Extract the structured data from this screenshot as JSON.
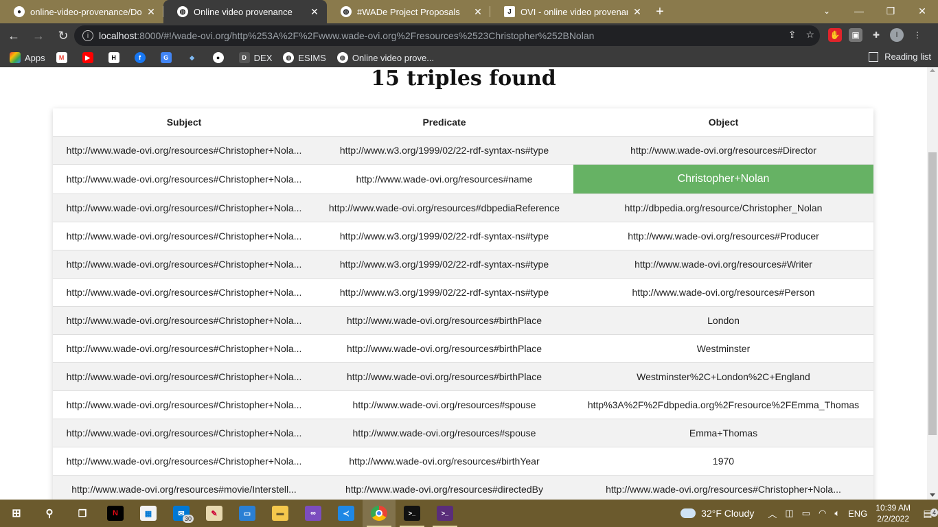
{
  "browser": {
    "tabs": [
      {
        "title": "online-video-provenance/Docum",
        "icon": "github-icon",
        "active": false
      },
      {
        "title": "Online video provenance",
        "icon": "globe-icon",
        "active": true
      },
      {
        "title": "#WADe Project Proposals",
        "icon": "globe-icon",
        "active": false
      },
      {
        "title": "OVI - online video provenance - ",
        "icon": "j-icon",
        "active": false
      }
    ],
    "url_host": "localhost",
    "url_rest": ":8000/#!/wade-ovi.org/http%253A%2F%2Fwww.wade-ovi.org%2Fresources%2523Christopher%252BNolan",
    "bookmarks": [
      {
        "label": "Apps",
        "icon": "apps-grid-icon"
      },
      {
        "label": "",
        "icon": "gmail-icon"
      },
      {
        "label": "",
        "icon": "youtube-icon"
      },
      {
        "label": "",
        "icon": "hbo-icon"
      },
      {
        "label": "",
        "icon": "facebook-icon"
      },
      {
        "label": "",
        "icon": "translate-icon"
      },
      {
        "label": "",
        "icon": "bird-icon"
      },
      {
        "label": "",
        "icon": "github-icon"
      },
      {
        "label": "DEX",
        "icon": "dex-icon"
      },
      {
        "label": "ESIMS",
        "icon": "globe-icon"
      },
      {
        "label": "Online video prove...",
        "icon": "globe-icon"
      }
    ],
    "reading_list": "Reading list",
    "profile_initial": "I"
  },
  "page": {
    "heading": "15 triples found",
    "columns": [
      "Subject",
      "Predicate",
      "Object"
    ],
    "rows": [
      [
        "http://www.wade-ovi.org/resources#Christopher+Nola...",
        "http://www.w3.org/1999/02/22-rdf-syntax-ns#type",
        "http://www.wade-ovi.org/resources#Director"
      ],
      [
        "http://www.wade-ovi.org/resources#Christopher+Nola...",
        "http://www.wade-ovi.org/resources#name",
        "Christopher+Nolan"
      ],
      [
        "http://www.wade-ovi.org/resources#Christopher+Nola...",
        "http://www.wade-ovi.org/resources#dbpediaReference",
        "http://dbpedia.org/resource/Christopher_Nolan"
      ],
      [
        "http://www.wade-ovi.org/resources#Christopher+Nola...",
        "http://www.w3.org/1999/02/22-rdf-syntax-ns#type",
        "http://www.wade-ovi.org/resources#Producer"
      ],
      [
        "http://www.wade-ovi.org/resources#Christopher+Nola...",
        "http://www.w3.org/1999/02/22-rdf-syntax-ns#type",
        "http://www.wade-ovi.org/resources#Writer"
      ],
      [
        "http://www.wade-ovi.org/resources#Christopher+Nola...",
        "http://www.w3.org/1999/02/22-rdf-syntax-ns#type",
        "http://www.wade-ovi.org/resources#Person"
      ],
      [
        "http://www.wade-ovi.org/resources#Christopher+Nola...",
        "http://www.wade-ovi.org/resources#birthPlace",
        "London"
      ],
      [
        "http://www.wade-ovi.org/resources#Christopher+Nola...",
        "http://www.wade-ovi.org/resources#birthPlace",
        "Westminster"
      ],
      [
        "http://www.wade-ovi.org/resources#Christopher+Nola...",
        "http://www.wade-ovi.org/resources#birthPlace",
        "Westminster%2C+London%2C+England"
      ],
      [
        "http://www.wade-ovi.org/resources#Christopher+Nola...",
        "http://www.wade-ovi.org/resources#spouse",
        "http%3A%2F%2Fdbpedia.org%2Fresource%2FEmma_Thomas"
      ],
      [
        "http://www.wade-ovi.org/resources#Christopher+Nola...",
        "http://www.wade-ovi.org/resources#spouse",
        "Emma+Thomas"
      ],
      [
        "http://www.wade-ovi.org/resources#Christopher+Nola...",
        "http://www.wade-ovi.org/resources#birthYear",
        "1970"
      ],
      [
        "http://www.wade-ovi.org/resources#movie/Interstell...",
        "http://www.wade-ovi.org/resources#directedBy",
        "http://www.wade-ovi.org/resources#Christopher+Nola..."
      ]
    ],
    "highlight_row": 1,
    "highlight_color": "#66b264"
  },
  "taskbar": {
    "apps": [
      "windows-start-icon",
      "search-icon",
      "task-view-icon",
      "netflix-icon",
      "store-icon",
      "mail-icon",
      "paint-icon",
      "remote-desktop-icon",
      "file-explorer-icon",
      "visual-studio-icon",
      "vscode-icon",
      "chrome-icon",
      "terminal-icon",
      "terminal-alt-icon"
    ],
    "mail_badge": "30",
    "weather": "32°F  Cloudy",
    "language": "ENG",
    "time": "10:39 AM",
    "date": "2/2/2022",
    "notifications": "4"
  }
}
